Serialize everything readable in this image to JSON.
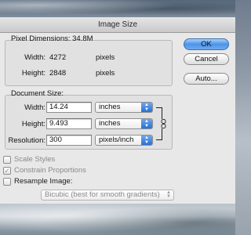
{
  "window": {
    "title": "Image Size"
  },
  "pixel_dimensions": {
    "title": "Pixel Dimensions:",
    "size": "34.8M",
    "width_label": "Width:",
    "width_value": "4272",
    "width_unit": "pixels",
    "height_label": "Height:",
    "height_value": "2848",
    "height_unit": "pixels"
  },
  "document_size": {
    "title": "Document Size:",
    "width_label": "Width:",
    "width_value": "14.24",
    "width_unit": "inches",
    "height_label": "Height:",
    "height_value": "9.493",
    "height_unit": "inches",
    "resolution_label": "Resolution:",
    "resolution_value": "300",
    "resolution_unit": "pixels/inch"
  },
  "options": {
    "scale_styles": "Scale Styles",
    "constrain_proportions": "Constrain Proportions",
    "resample_image": "Resample Image:",
    "resample_method": "Bicubic (best for smooth gradients)"
  },
  "buttons": {
    "ok": "OK",
    "cancel": "Cancel",
    "auto": "Auto..."
  }
}
